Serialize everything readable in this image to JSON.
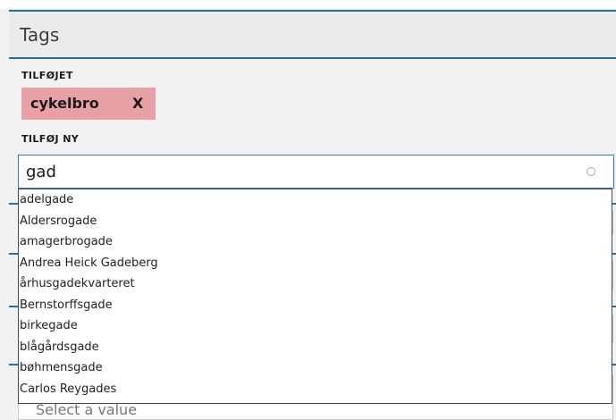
{
  "panel": {
    "title": "Tags"
  },
  "added": {
    "label": "TILFØJET",
    "tags": [
      {
        "text": "cykelbro",
        "remove_label": "X"
      }
    ]
  },
  "add_new": {
    "label": "TILFØJ NY",
    "input_value": "gad"
  },
  "suggestions": [
    "adelgade",
    "Aldersrogade",
    "amagerbrogade",
    "Andrea Heick Gadeberg",
    "århusgadekvarteret",
    "Bernstorffsgade",
    "birkegade",
    "blågårdsgade",
    "bøhmensgade",
    "Carlos Reygades"
  ],
  "below_select": {
    "placeholder": "Select a value"
  },
  "colors": {
    "accent": "#1f6fad",
    "tag_bg": "#e7a1a4",
    "panel_bg": "#f2f2f2"
  }
}
